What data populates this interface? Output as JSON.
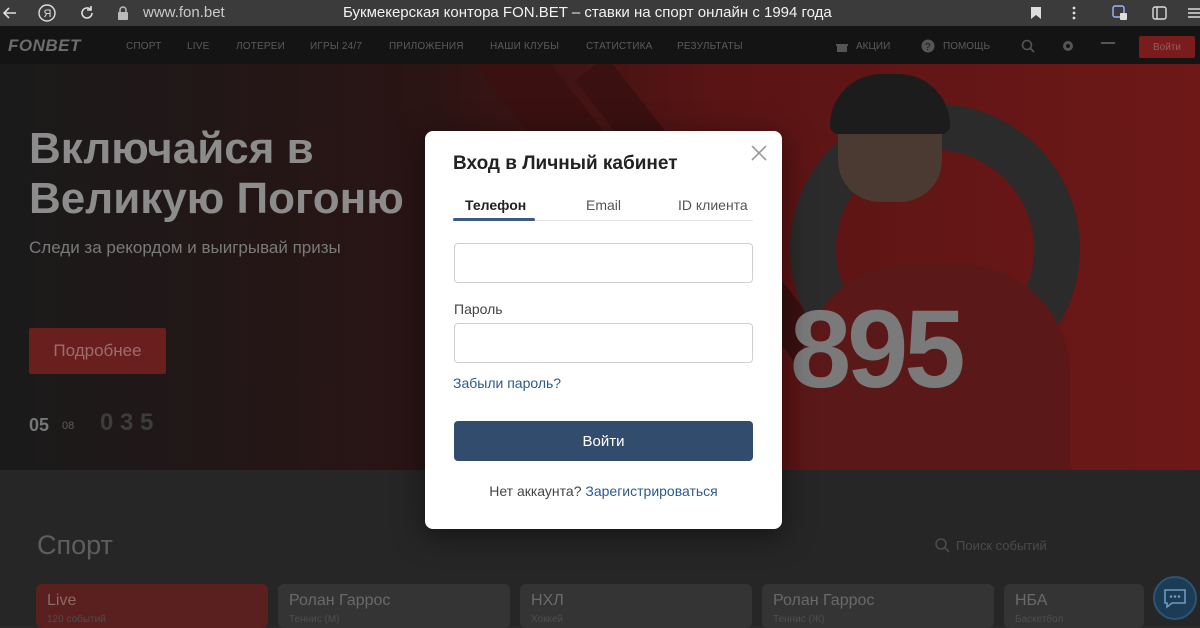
{
  "browser": {
    "url": "www.fon.bet",
    "tab_title": "Букмекерская контора FON.BET – ставки на спорт онлайн с 1994 года"
  },
  "site_nav": {
    "logo": "FONBET",
    "items": [
      "Спорт",
      "Live",
      "Лотереи",
      "Игры 24/7",
      "Приложения",
      "Наши клубы",
      "Статистика",
      "Результаты"
    ],
    "promo": "АКЦИИ",
    "help": "ПОМОЩЬ",
    "login": "Войти"
  },
  "hero": {
    "title": "Включайся в Великую Погоню",
    "subtitle": "Следи за рекордом и выигрывай призы",
    "button": "Подробнее",
    "date_day": "05",
    "date_month": "08",
    "count": "0 3 5",
    "jersey_number": "895"
  },
  "sport": {
    "title": "Спорт",
    "search_placeholder": "Поиск событий",
    "cards": [
      {
        "name": "Live",
        "sub": "120 событий"
      },
      {
        "name": "Ролан Гаррос",
        "sub": "Теннис (М)"
      },
      {
        "name": "НХЛ",
        "sub": "Хоккей"
      },
      {
        "name": "Ролан Гаррос",
        "sub": "Теннис (Ж)"
      },
      {
        "name": "НБА",
        "sub": "Баскетбол"
      }
    ]
  },
  "login_modal": {
    "title": "Вход в Личный кабинет",
    "tabs": [
      "Телефон",
      "Email",
      "ID клиента"
    ],
    "active_tab": "Телефон",
    "phone_value": "",
    "password_label": "Пароль",
    "password_value": "",
    "forgot_link": "Забыли пароль?",
    "submit_label": "Войти",
    "no_account_text": "Нет аккаунта?",
    "register_link": "Зарегистрироваться"
  },
  "colors": {
    "primary_button": "#324c6d",
    "link": "#2d5b8a",
    "brand_red": "#c8102e"
  }
}
